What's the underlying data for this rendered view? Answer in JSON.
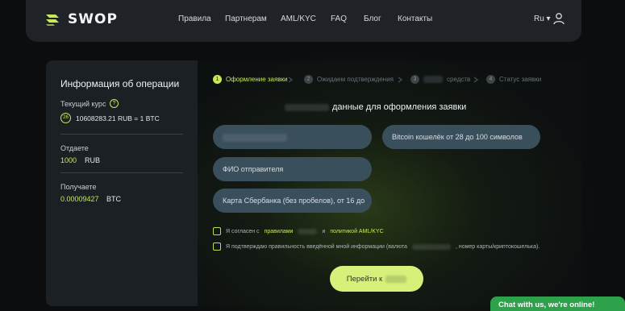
{
  "brand": {
    "name": "SWOP",
    "accent": "#c6e85a"
  },
  "nav": {
    "items": [
      "Правила",
      "Партнерам",
      "AML/KYC",
      "FAQ",
      "Блог",
      "Контакты"
    ],
    "lang": "Ru ▾"
  },
  "sidebar": {
    "title": "Информация об операции",
    "rate_label": "Текущий курс",
    "timer": "26",
    "rate_value": "10608283.21 RUB = 1 BTC",
    "give_label": "Отдаете",
    "give_amount": "1000",
    "give_currency": "RUB",
    "get_label": "Получаете",
    "get_amount": "0.00009427",
    "get_currency": "BTC"
  },
  "steps": [
    {
      "num": "1",
      "label": "Оформление заявки",
      "active": true
    },
    {
      "num": "2",
      "label": "Ожидаем подтверждения",
      "active": false
    },
    {
      "num": "3",
      "label": "средств",
      "active": false
    },
    {
      "num": "4",
      "label": "Статус заявки",
      "active": false
    }
  ],
  "form": {
    "title": "данные для оформления заявки",
    "field_wallet": "Bitcoin кошелёк от 28 до 100 символов",
    "field_name": "ФИО отправителя",
    "field_card": "Карта Сбербанка (без пробелов), от 16 до",
    "agree_prefix": "Я согласен с",
    "agree_rules": "правилами",
    "agree_and": "и",
    "agree_policy": "политикой AML/KYC",
    "confirm_prefix": "Я подтверждаю правильность введённой мной информации (валюта",
    "confirm_suffix": ", номер карты/криптокошелька).",
    "submit": "Перейти к"
  },
  "chat": {
    "label": "Chat with us, we're online!"
  }
}
